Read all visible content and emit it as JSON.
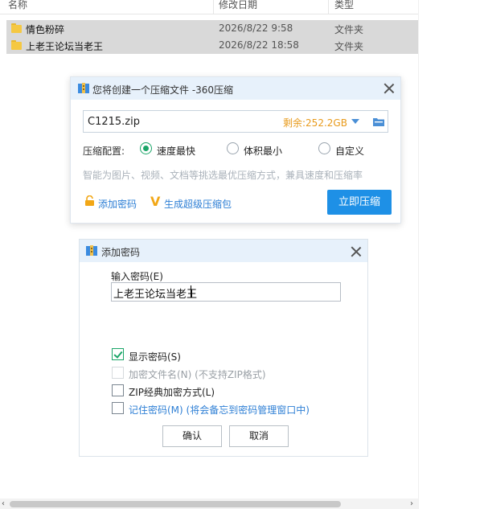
{
  "explorer": {
    "columns": {
      "name": "名称",
      "date": "修改日期",
      "type": "类型"
    },
    "files": [
      {
        "name": "情色粉碎",
        "date": "2026/8/22 9:58",
        "type": "文件夹"
      },
      {
        "name": "上老王论坛当老王",
        "date": "2026/8/22 18:58",
        "type": "文件夹"
      }
    ]
  },
  "zip_dialog": {
    "title": "您将创建一个压缩文件 -360压缩",
    "filename": "C1215.zip",
    "free_space": "剩余:252.2GB",
    "config_label": "压缩配置:",
    "options": [
      "速度最快",
      "体积最小",
      "自定义"
    ],
    "selected_option": "速度最快",
    "hint": "智能为图片、视频、文档等挑选最优压缩方式，兼具速度和压缩率",
    "add_password": "添加密码",
    "super_pack": "生成超级压缩包",
    "compress_button": "立即压缩",
    "accent_color": "#1e90e6"
  },
  "password_dialog": {
    "title": "添加密码",
    "input_label": "输入密码(E)",
    "password_value": "上老王论坛当老王",
    "show_password": "显示密码(S)",
    "encrypt_filenames": "加密文件名(N) (不支持ZIP格式)",
    "zip_classic": "ZIP经典加密方式(L)",
    "remember_password": "记住密码(M) (将会备忘到密码管理窗口中)",
    "ok_button": "确认",
    "cancel_button": "取消"
  },
  "scrollbar": {
    "left_arrow": "‹",
    "right_arrow": "›"
  }
}
